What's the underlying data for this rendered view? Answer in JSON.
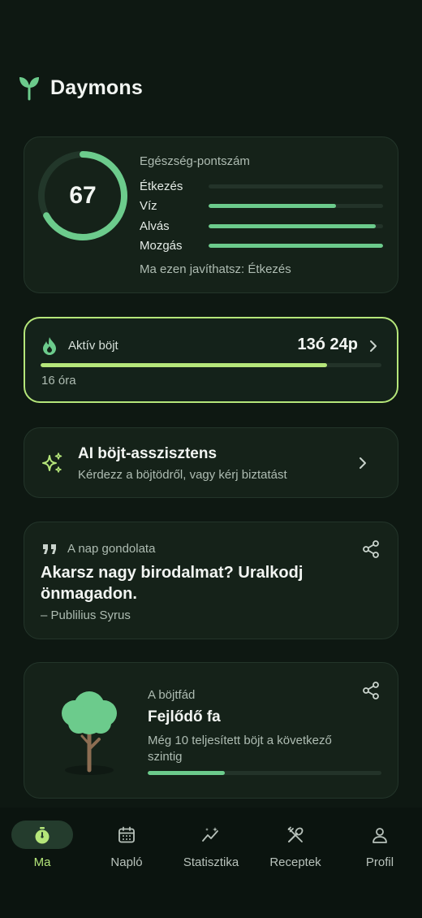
{
  "app": {
    "title": "Daymons"
  },
  "health": {
    "title": "Egészség-pontszám",
    "score": "67",
    "score_value": 67,
    "metrics": [
      {
        "label": "Étkezés",
        "value": 0.0
      },
      {
        "label": "Víz",
        "value": 0.73
      },
      {
        "label": "Alvás",
        "value": 0.96
      },
      {
        "label": "Mozgás",
        "value": 1.0
      }
    ],
    "tip": "Ma ezen javíthatsz: Étkezés",
    "colors": {
      "accent": "#6ccb8c"
    }
  },
  "fast": {
    "label": "Aktív böjt",
    "elapsed": "13ó 24p",
    "goal": "16 óra",
    "progress": 0.84,
    "colors": {
      "accent": "#b5e67a"
    }
  },
  "ai": {
    "title": "AI böjt-asszisztens",
    "subtitle": "Kérdezz a böjtödről, vagy kérj biztatást"
  },
  "quote": {
    "label": "A nap gondolata",
    "text": "Akarsz nagy birodalmat? Uralkodj önmagadon.",
    "author": "– Publilius Syrus"
  },
  "tree": {
    "label": "A böjtfád",
    "title": "Fejlődő fa",
    "description": "Még 10 teljesített böjt a következő szintig",
    "progress": 0.33
  },
  "nav": {
    "items": [
      {
        "label": "Ma",
        "icon": "stopwatch-icon",
        "active": true
      },
      {
        "label": "Napló",
        "icon": "calendar-icon",
        "active": false
      },
      {
        "label": "Statisztika",
        "icon": "chart-sparkle-icon",
        "active": false
      },
      {
        "label": "Receptek",
        "icon": "utensils-icon",
        "active": false
      },
      {
        "label": "Profil",
        "icon": "user-icon",
        "active": false
      }
    ]
  }
}
